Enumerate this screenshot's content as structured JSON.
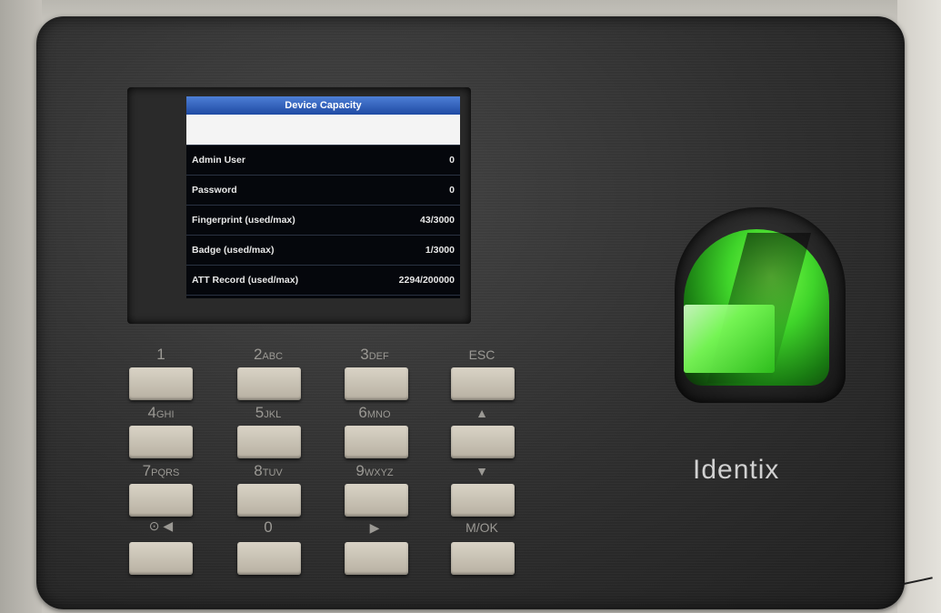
{
  "screen": {
    "title": "Device Capacity",
    "rows": [
      {
        "label": "",
        "value": ""
      },
      {
        "label": "Admin User",
        "value": "0"
      },
      {
        "label": "Password",
        "value": "0"
      },
      {
        "label": "Fingerprint (used/max)",
        "value": "43/3000"
      },
      {
        "label": "Badge (used/max)",
        "value": "1/3000"
      },
      {
        "label": "ATT Record (used/max)",
        "value": "2294/200000"
      }
    ]
  },
  "keypad": {
    "k1": "1",
    "k2": "2",
    "k2_sub": "ABC",
    "k3": "3",
    "k3_sub": "DEF",
    "esc": "ESC",
    "k4": "4",
    "k4_sub": "GHI",
    "k5": "5",
    "k5_sub": "JKL",
    "k6": "6",
    "k6_sub": "MNO",
    "up": "▲",
    "k7": "7",
    "k7_sub": "PQRS",
    "k8": "8",
    "k8_sub": "TUV",
    "k9": "9",
    "k9_sub": "WXYZ",
    "down": "▼",
    "left": "⊙ ◀",
    "k0": "0",
    "right": "▶",
    "ok": "M/OK"
  },
  "brand": "Identix",
  "colors": {
    "title_bar": "#2f5fbf",
    "sensor_glow": "#4cff2a",
    "key": "#c9c2b4"
  }
}
